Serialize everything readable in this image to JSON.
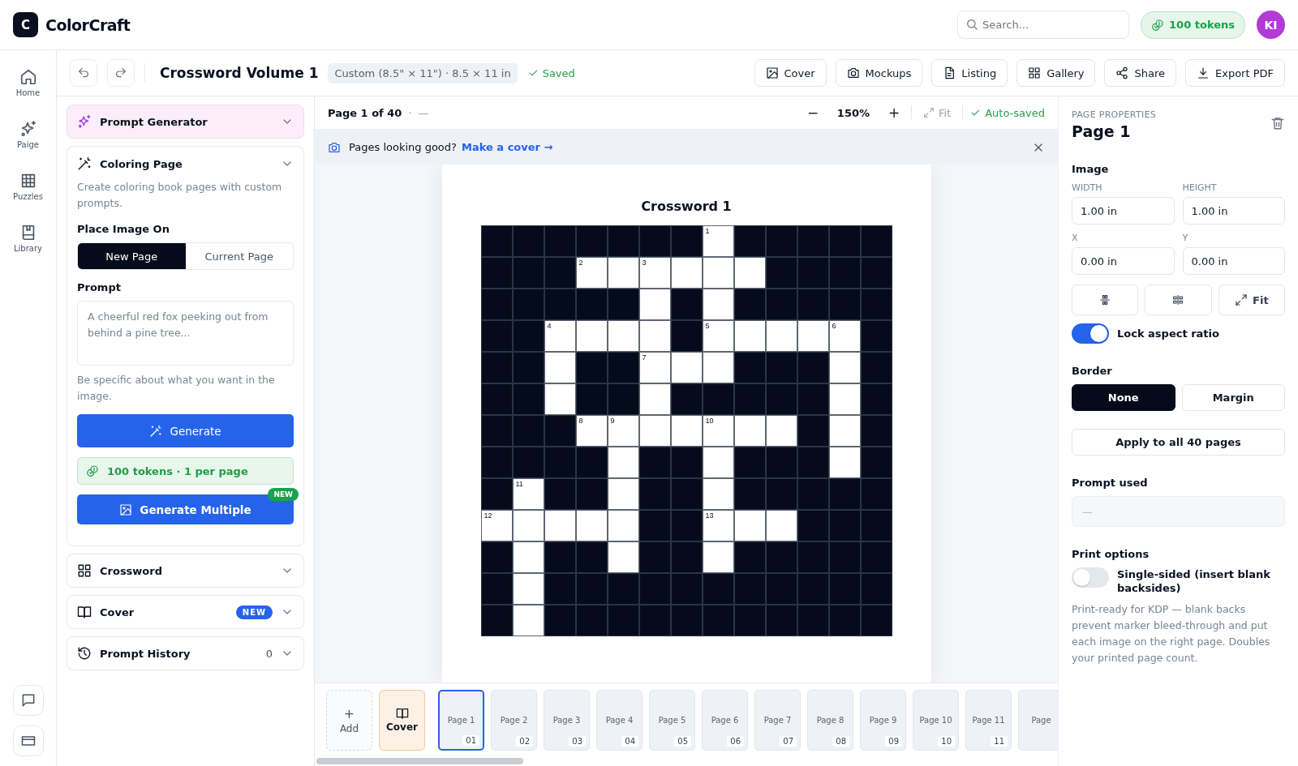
{
  "app": {
    "logo": "C",
    "name": "ColorCraft"
  },
  "search": {
    "placeholder": "Search..."
  },
  "tokens": "100 tokens",
  "avatar": "KI",
  "nav": [
    {
      "label": "Home"
    },
    {
      "label": "Paige"
    },
    {
      "label": "Puzzles"
    },
    {
      "label": "Library"
    }
  ],
  "toolbar": {
    "title": "Crossword Volume 1",
    "size": "Custom (8.5\" × 11\") · 8.5 × 11 in",
    "status": "Saved",
    "actions": [
      {
        "label": "Cover"
      },
      {
        "label": "Mockups"
      },
      {
        "label": "Listing"
      },
      {
        "label": "Gallery"
      },
      {
        "label": "Share"
      },
      {
        "label": "Export PDF"
      }
    ]
  },
  "prompt_generator": {
    "title": "Prompt Generator"
  },
  "coloring_page": {
    "title": "Coloring Page",
    "description": "Create coloring book pages with custom prompts.",
    "place_label": "Place Image On",
    "place_options": [
      {
        "label": "New Page",
        "selected": true
      },
      {
        "label": "Current Page",
        "selected": false
      }
    ],
    "prompt_label": "Prompt",
    "prompt_placeholder": "A cheerful red fox peeking out from behind a pine tree...",
    "hint": "Be specific about what you want in the image.",
    "generate": "Generate",
    "tokens_note": "100 tokens · 1 per page",
    "generate_multiple": "Generate Multiple",
    "multiple_badge": "NEW"
  },
  "sections": [
    {
      "title": "Crossword"
    },
    {
      "title": "Cover",
      "badge": "NEW"
    },
    {
      "title": "Prompt History",
      "count": "0"
    }
  ],
  "canvas": {
    "page_label": "Page 1 of 40",
    "separator": "·",
    "dash": "—",
    "zoom_out": "−",
    "zoom": "150%",
    "zoom_in": "+",
    "fit": "Fit",
    "autosave": "Auto-saved",
    "banner": {
      "text": "Pages looking good?",
      "link": "Make a cover →"
    },
    "page_title": "Crossword 1",
    "crossword": {
      "rows": [
        [
          false,
          false,
          false,
          false,
          false,
          false,
          false,
          "1",
          false,
          false,
          false,
          false,
          false
        ],
        [
          false,
          false,
          false,
          "2",
          true,
          "3",
          true,
          true,
          true,
          false,
          false,
          false,
          false
        ],
        [
          false,
          false,
          false,
          false,
          false,
          true,
          false,
          true,
          false,
          false,
          false,
          false,
          false
        ],
        [
          false,
          false,
          "4",
          true,
          true,
          true,
          false,
          "5",
          true,
          true,
          true,
          "6",
          false
        ],
        [
          false,
          false,
          true,
          false,
          false,
          "7",
          true,
          true,
          false,
          false,
          false,
          true,
          false
        ],
        [
          false,
          false,
          true,
          false,
          false,
          true,
          false,
          false,
          false,
          false,
          false,
          true,
          false
        ],
        [
          false,
          false,
          false,
          "8",
          "9",
          true,
          true,
          "10",
          true,
          true,
          false,
          true,
          false
        ],
        [
          false,
          false,
          false,
          false,
          true,
          false,
          false,
          true,
          false,
          false,
          false,
          true,
          false
        ],
        [
          false,
          "11",
          false,
          false,
          true,
          false,
          false,
          true,
          false,
          false,
          false,
          false,
          false
        ],
        [
          "12",
          true,
          true,
          true,
          true,
          false,
          false,
          "13",
          true,
          true,
          false,
          false,
          false
        ],
        [
          false,
          true,
          false,
          false,
          true,
          false,
          false,
          true,
          false,
          false,
          false,
          false,
          false
        ],
        [
          false,
          true,
          false,
          false,
          false,
          false,
          false,
          false,
          false,
          false,
          false,
          false,
          false
        ],
        [
          false,
          true,
          false,
          false,
          false,
          false,
          false,
          false,
          false,
          false,
          false,
          false,
          false
        ]
      ]
    }
  },
  "filmstrip": {
    "add_icon": "+",
    "add": "Add",
    "cover": "Cover",
    "pages": [
      {
        "label": "Page 1",
        "number": "01",
        "selected": true
      },
      {
        "label": "Page 2",
        "number": "02",
        "selected": false
      },
      {
        "label": "Page 3",
        "number": "03",
        "selected": false
      },
      {
        "label": "Page 4",
        "number": "04",
        "selected": false
      },
      {
        "label": "Page 5",
        "number": "05",
        "selected": false
      },
      {
        "label": "Page 6",
        "number": "06",
        "selected": false
      },
      {
        "label": "Page 7",
        "number": "07",
        "selected": false
      },
      {
        "label": "Page 8",
        "number": "08",
        "selected": false
      },
      {
        "label": "Page 9",
        "number": "09",
        "selected": false
      },
      {
        "label": "Page 10",
        "number": "10",
        "selected": false
      },
      {
        "label": "Page 11",
        "number": "11",
        "selected": false
      },
      {
        "label": "Page",
        "selected": false
      }
    ]
  },
  "properties": {
    "eyebrow": "PAGE PROPERTIES",
    "title": "Page 1",
    "image_label": "Image",
    "fields": [
      {
        "label": "WIDTH",
        "value": "1.00 in"
      },
      {
        "label": "HEIGHT",
        "value": "1.00 in"
      },
      {
        "label": "X",
        "value": "0.00 in"
      },
      {
        "label": "Y",
        "value": "0.00 in"
      }
    ],
    "fit": "Fit",
    "lock": {
      "label": "Lock aspect ratio",
      "on": true
    },
    "border_label": "Border",
    "border_options": [
      {
        "label": "None",
        "selected": true
      },
      {
        "label": "Margin",
        "selected": false
      }
    ],
    "apply": "Apply to all 40 pages",
    "prompt_used_label": "Prompt used",
    "prompt_used": "—",
    "print_label": "Print options",
    "single_sided": {
      "label": "Single-sided (insert blank backsides)",
      "on": false
    },
    "print_note": "Print-ready for KDP — blank backs prevent marker bleed-through and put each image on the right page. Doubles your printed page count."
  }
}
